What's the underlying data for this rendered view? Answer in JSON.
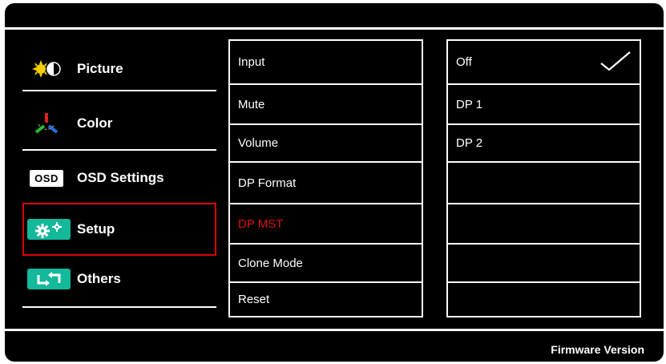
{
  "menu": {
    "items": [
      {
        "label": "Picture",
        "icon": "picture-brightness-icon"
      },
      {
        "label": "Color",
        "icon": "color-rgb-icon"
      },
      {
        "label": "OSD Settings",
        "icon": "osd-icon",
        "icon_text": "OSD"
      },
      {
        "label": "Setup",
        "icon": "setup-gears-icon",
        "selected": true
      },
      {
        "label": "Others",
        "icon": "others-arrows-icon"
      }
    ]
  },
  "options": {
    "items": [
      "Input",
      "Mute",
      "Volume",
      "DP Format",
      "DP MST",
      "Clone Mode",
      "Reset"
    ],
    "highlighted": "DP MST"
  },
  "values": {
    "items": [
      "Off",
      "DP 1",
      "DP 2",
      "",
      "",
      "",
      ""
    ],
    "checked": "Off"
  },
  "footer": {
    "label": "Firmware Version"
  },
  "colors": {
    "background": "#000000",
    "foreground": "#ffffff",
    "selection": "#e00000",
    "teal": "#14b89a"
  }
}
